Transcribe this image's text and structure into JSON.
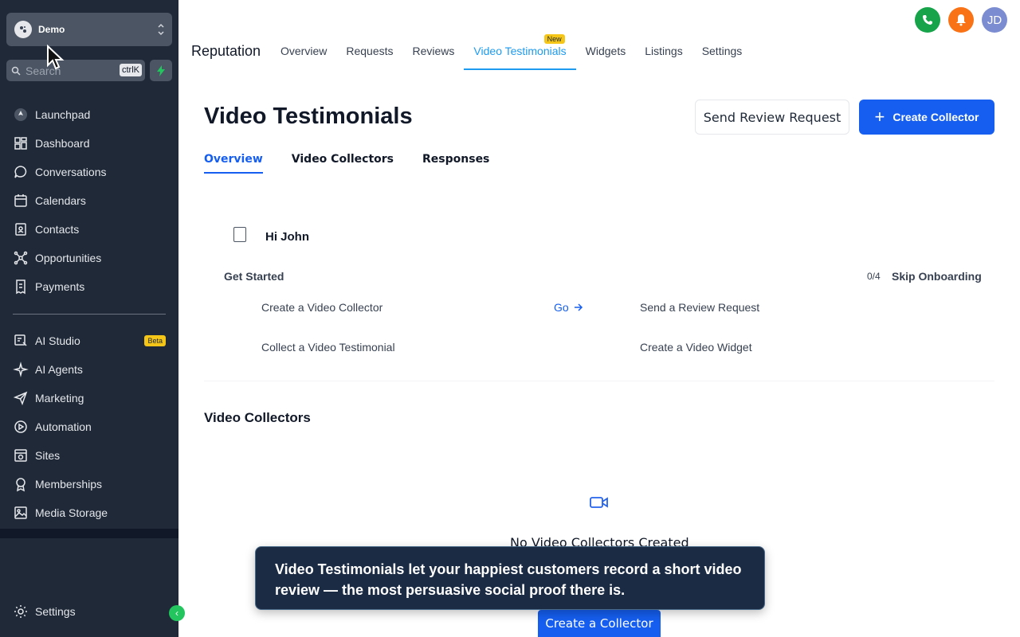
{
  "account": {
    "name": "Demo"
  },
  "search": {
    "label": "Search",
    "shortcut": "ctrlK"
  },
  "sidebar": {
    "items": [
      {
        "label": "Launchpad",
        "icon": "rocket-icon"
      },
      {
        "label": "Dashboard",
        "icon": "grid-icon"
      },
      {
        "label": "Conversations",
        "icon": "chat-icon"
      },
      {
        "label": "Calendars",
        "icon": "calendar-icon"
      },
      {
        "label": "Contacts",
        "icon": "contacts-icon"
      },
      {
        "label": "Opportunities",
        "icon": "network-icon"
      },
      {
        "label": "Payments",
        "icon": "receipt-icon"
      }
    ],
    "items2": [
      {
        "label": "AI Studio",
        "icon": "ai-studio-icon",
        "badge": "Beta"
      },
      {
        "label": "AI Agents",
        "icon": "sparkle-icon"
      },
      {
        "label": "Marketing",
        "icon": "send-icon"
      },
      {
        "label": "Automation",
        "icon": "automation-icon"
      },
      {
        "label": "Sites",
        "icon": "sites-icon"
      },
      {
        "label": "Memberships",
        "icon": "memberships-icon"
      },
      {
        "label": "Media Storage",
        "icon": "image-icon"
      }
    ],
    "settings": "Settings"
  },
  "header": {
    "title": "Reputation",
    "tabs": [
      "Overview",
      "Requests",
      "Reviews",
      "Video Testimonials",
      "Widgets",
      "Listings",
      "Settings"
    ],
    "active_tab": "Video Testimonials",
    "new_badge": "New",
    "avatar_initials": "JD"
  },
  "main": {
    "title": "Video Testimonials",
    "send_review_request": "Send Review Request",
    "create_collector": "Create Collector",
    "subtabs": [
      "Overview",
      "Video Collectors",
      "Responses"
    ],
    "greeting": "Hi John",
    "get_started": "Get Started",
    "progress": "0/4",
    "skip": "Skip Onboarding",
    "tasks": [
      "Create a Video Collector",
      "Send a Review Request",
      "Collect a Video Testimonial",
      "Create a Video Widget"
    ],
    "go": "Go",
    "section_title": "Video Collectors",
    "empty_title": "No Video Collectors Created",
    "create_a_collector": "Create a Collector"
  },
  "tooltip": {
    "text": "Video Testimonials let your happiest customers record a short video review — the most persuasive social proof there is."
  },
  "colors": {
    "primary": "#155eef",
    "sidebar_bg": "#1f2937",
    "accent_tab": "#1d9bf0",
    "phone": "#16a34a",
    "bell": "#f97316",
    "avatar": "#7c8cd1"
  }
}
